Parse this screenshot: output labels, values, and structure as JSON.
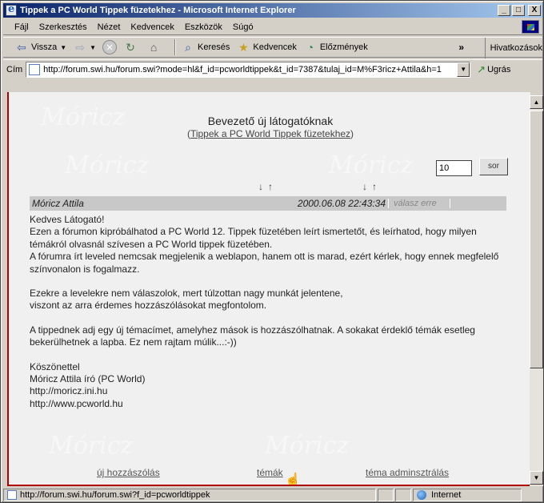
{
  "window": {
    "title": "Tippek a PC World Tippek füzetekhez - Microsoft Internet Explorer",
    "buttons": {
      "minimize": "_",
      "maximize": "□",
      "close": "X"
    }
  },
  "menu": {
    "items": [
      "Fájl",
      "Szerkesztés",
      "Nézet",
      "Kedvencek",
      "Eszközök",
      "Súgó"
    ]
  },
  "toolbar": {
    "back": "Vissza",
    "search": "Keresés",
    "favorites": "Kedvencek",
    "history": "Előzmények",
    "overflow": "»",
    "links": "Hivatkozások"
  },
  "address": {
    "label": "Cím",
    "url": "http://forum.swi.hu/forum.swi?mode=hl&f_id=pcworldtippek&t_id=7387&tulaj_id=M%F3ricz+Attila&h=1",
    "go": "Ugrás"
  },
  "page": {
    "heading": "Bevezető új látogatóknak",
    "subheading_link": "Tippek a PC World Tippek füzetekhez",
    "rows_value": "10",
    "rows_button": "sor",
    "sort_arrows": "↓↑",
    "post": {
      "author": "Móricz Attila",
      "date": "2000.06.08 22:43:34",
      "reply": "válasz erre",
      "body": {
        "p1": "Kedves Látogató!",
        "p2": "Ezen a fórumon kipróbálhatod a PC World 12. Tippek füzetében leírt ismertetőt, és leírhatod, hogy milyen témákról olvasnál szívesen a PC World tippek füzetében.",
        "p3": "A fórumra írt leveled nemcsak megjelenik a weblapon, hanem ott is marad, ezért kérlek, hogy ennek megfelelő színvonalon is fogalmazz.",
        "p4": "Ezekre a levelekre nem válaszolok, mert túlzottan nagy munkát jelentene,",
        "p5": "viszont az arra érdemes hozzászólásokat megfontolom.",
        "p6": "A tippednek adj egy új témacímet, amelyhez mások is hozzászólhatnak. A sokakat érdeklő témák esetleg bekerülhetnek a lapba. Ez nem rajtam múlik...:-))",
        "sig1": "Köszönettel",
        "sig2": "Móricz Attila író (PC World)",
        "sig3": "http://moricz.ini.hu",
        "sig4": "http://www.pcworld.hu"
      }
    },
    "footer": {
      "new_post": "új hozzászólás",
      "topics": "témák",
      "topic_admin": "téma adminsztrálás"
    },
    "watermark": "Móricz"
  },
  "status": {
    "url": "http://forum.swi.hu/forum.swi?f_id=pcworldtippek",
    "zone": "Internet"
  }
}
